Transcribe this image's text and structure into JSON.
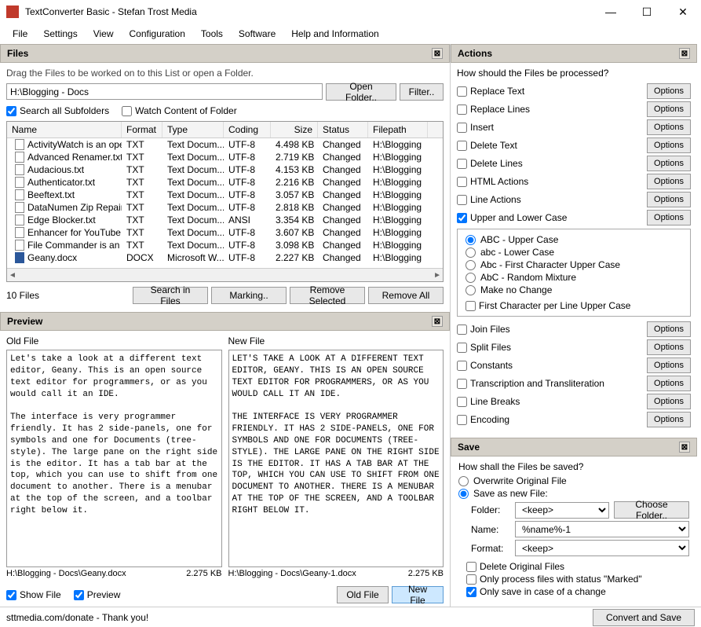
{
  "window": {
    "title": "TextConverter Basic - Stefan Trost Media"
  },
  "menu": [
    "File",
    "Settings",
    "View",
    "Configuration",
    "Tools",
    "Software",
    "Help and Information"
  ],
  "files": {
    "panel_title": "Files",
    "hint": "Drag the Files to be worked on to this List or open a Folder.",
    "path": "H:\\Blogging - Docs",
    "open_folder": "Open Folder..",
    "filter": "Filter..",
    "search_subfolders": "Search all Subfolders",
    "watch_content": "Watch Content of Folder",
    "columns": {
      "name": "Name",
      "format": "Format",
      "type": "Type",
      "coding": "Coding",
      "size": "Size",
      "status": "Status",
      "filepath": "Filepath"
    },
    "rows": [
      {
        "name": "ActivityWatch is an ope...",
        "format": "TXT",
        "type": "Text Docum...",
        "coding": "UTF-8",
        "size": "4.498 KB",
        "status": "Changed",
        "path": "H:\\Blogging"
      },
      {
        "name": "Advanced Renamer.txt",
        "format": "TXT",
        "type": "Text Docum...",
        "coding": "UTF-8",
        "size": "2.719 KB",
        "status": "Changed",
        "path": "H:\\Blogging"
      },
      {
        "name": "Audacious.txt",
        "format": "TXT",
        "type": "Text Docum...",
        "coding": "UTF-8",
        "size": "4.153 KB",
        "status": "Changed",
        "path": "H:\\Blogging"
      },
      {
        "name": "Authenticator.txt",
        "format": "TXT",
        "type": "Text Docum...",
        "coding": "UTF-8",
        "size": "2.216 KB",
        "status": "Changed",
        "path": "H:\\Blogging"
      },
      {
        "name": "Beeftext.txt",
        "format": "TXT",
        "type": "Text Docum...",
        "coding": "UTF-8",
        "size": "3.057 KB",
        "status": "Changed",
        "path": "H:\\Blogging"
      },
      {
        "name": "DataNumen Zip Repair.txt",
        "format": "TXT",
        "type": "Text Docum...",
        "coding": "UTF-8",
        "size": "2.818 KB",
        "status": "Changed",
        "path": "H:\\Blogging"
      },
      {
        "name": "Edge Blocker.txt",
        "format": "TXT",
        "type": "Text Docum...",
        "coding": "ANSI",
        "size": "3.354 KB",
        "status": "Changed",
        "path": "H:\\Blogging"
      },
      {
        "name": "Enhancer for YouTube.txt",
        "format": "TXT",
        "type": "Text Docum...",
        "coding": "UTF-8",
        "size": "3.607 KB",
        "status": "Changed",
        "path": "H:\\Blogging"
      },
      {
        "name": "File Commander is an o...",
        "format": "TXT",
        "type": "Text Docum...",
        "coding": "UTF-8",
        "size": "3.098 KB",
        "status": "Changed",
        "path": "H:\\Blogging"
      },
      {
        "name": "Geany.docx",
        "format": "DOCX",
        "type": "Microsoft W...",
        "coding": "UTF-8",
        "size": "2.227 KB",
        "status": "Changed",
        "path": "H:\\Blogging",
        "docx": true
      }
    ],
    "count": "10 Files",
    "search_in_files": "Search in Files",
    "marking": "Marking..",
    "remove_selected": "Remove Selected",
    "remove_all": "Remove All"
  },
  "preview": {
    "panel_title": "Preview",
    "old_label": "Old File",
    "new_label": "New File",
    "old_text": "Let's take a look at a different text editor, Geany. This is an open source text editor for programmers, or as you would call it an IDE.\n\nThe interface is very programmer friendly. It has 2 side-panels, one for symbols and one for Documents (tree-style). The large pane on the right side is the editor. It has a tab bar at the top, which you can use to shift from one document to another. There is a menubar at the top of the screen, and a toolbar right below it.",
    "new_text": "LET'S TAKE A LOOK AT A DIFFERENT TEXT EDITOR, GEANY. THIS IS AN OPEN SOURCE TEXT EDITOR FOR PROGRAMMERS, OR AS YOU WOULD CALL IT AN IDE.\n\nTHE INTERFACE IS VERY PROGRAMMER FRIENDLY. IT HAS 2 SIDE-PANELS, ONE FOR SYMBOLS AND ONE FOR DOCUMENTS (TREE-STYLE). THE LARGE PANE ON THE RIGHT SIDE IS THE EDITOR. IT HAS A TAB BAR AT THE TOP, WHICH YOU CAN USE TO SHIFT FROM ONE DOCUMENT TO ANOTHER. THERE IS A MENUBAR AT THE TOP OF THE SCREEN, AND A TOOLBAR RIGHT BELOW IT.",
    "old_path": "H:\\Blogging - Docs\\Geany.docx",
    "old_size": "2.275 KB",
    "new_path": "H:\\Blogging - Docs\\Geany-1.docx",
    "new_size": "2.275 KB",
    "show_file": "Show File",
    "preview_chk": "Preview",
    "old_btn": "Old File",
    "new_btn": "New File"
  },
  "actions": {
    "panel_title": "Actions",
    "question": "How should the Files be processed?",
    "opts": "Options",
    "items1": [
      "Replace Text",
      "Replace Lines",
      "Insert",
      "Delete Text",
      "Delete Lines",
      "HTML Actions",
      "Line Actions",
      "Upper and Lower Case"
    ],
    "case": {
      "upper": "ABC - Upper Case",
      "lower": "abc - Lower Case",
      "first": "Abc - First Character Upper Case",
      "random": "AbC - Random Mixture",
      "none": "Make no Change",
      "firstline": "First Character per Line Upper Case"
    },
    "items2": [
      "Join Files",
      "Split Files",
      "Constants",
      "Transcription and Transliteration",
      "Line Breaks",
      "Encoding"
    ]
  },
  "save": {
    "panel_title": "Save",
    "question": "How shall the Files be saved?",
    "overwrite": "Overwrite Original File",
    "saveas": "Save as new File:",
    "folder_lbl": "Folder:",
    "folder_val": "<keep>",
    "choose_folder": "Choose Folder..",
    "name_lbl": "Name:",
    "name_val": "%name%-1",
    "format_lbl": "Format:",
    "format_val": "<keep>",
    "delete_orig": "Delete Original Files",
    "only_marked": "Only process files with status \"Marked\"",
    "only_change": "Only save in case of a change"
  },
  "status": {
    "donate": "sttmedia.com/donate - Thank you!",
    "convert": "Convert and Save"
  }
}
